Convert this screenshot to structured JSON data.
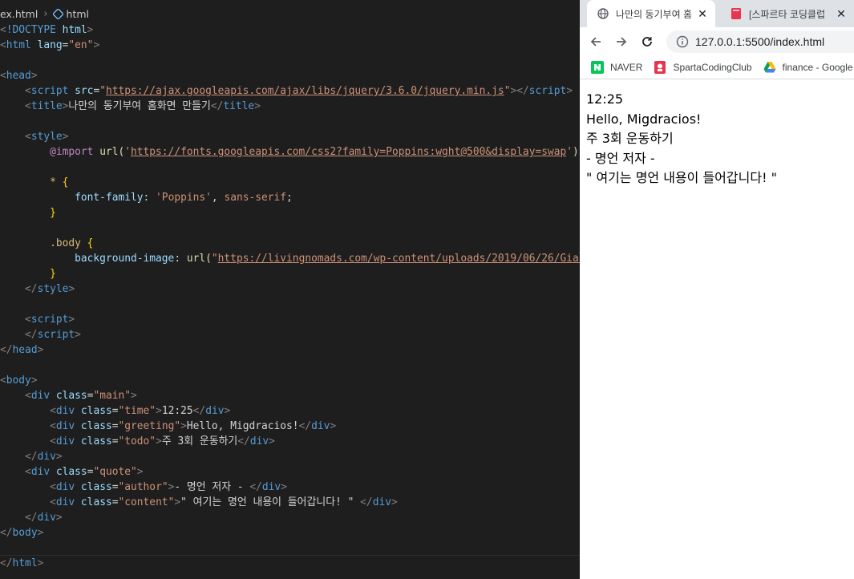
{
  "editor": {
    "breadcrumb": {
      "file": "ex.html",
      "symbol": "html"
    }
  },
  "browser": {
    "tabs": [
      {
        "title": "나만의 동기부여 홈",
        "close": "✕",
        "favicon": "globe-icon"
      },
      {
        "title": "[스파르타 코딩클럽",
        "close": "✕",
        "favicon": "book-icon"
      }
    ],
    "url": "127.0.0.1:5500/index.html",
    "bookmarks": [
      {
        "label": "NAVER",
        "icon": "naver-icon"
      },
      {
        "label": "SpartaCodingClub",
        "icon": "sparta-icon"
      },
      {
        "label": "finance - Google",
        "icon": "google-drive-icon"
      }
    ],
    "page": {
      "time": "12:25",
      "greeting": "Hello, Migdracios!",
      "todo": "주 3회 운동하기",
      "author": "- 명언 저자 -",
      "content": "\" 여기는 명언 내용이 들어갑니다! \""
    }
  },
  "colors": {
    "editor_bg": "#1e1e1e",
    "tag": "#569cd6",
    "attribute": "#9cdcfe",
    "string": "#ce9178",
    "browser_tabstrip": "#dee1e6"
  }
}
